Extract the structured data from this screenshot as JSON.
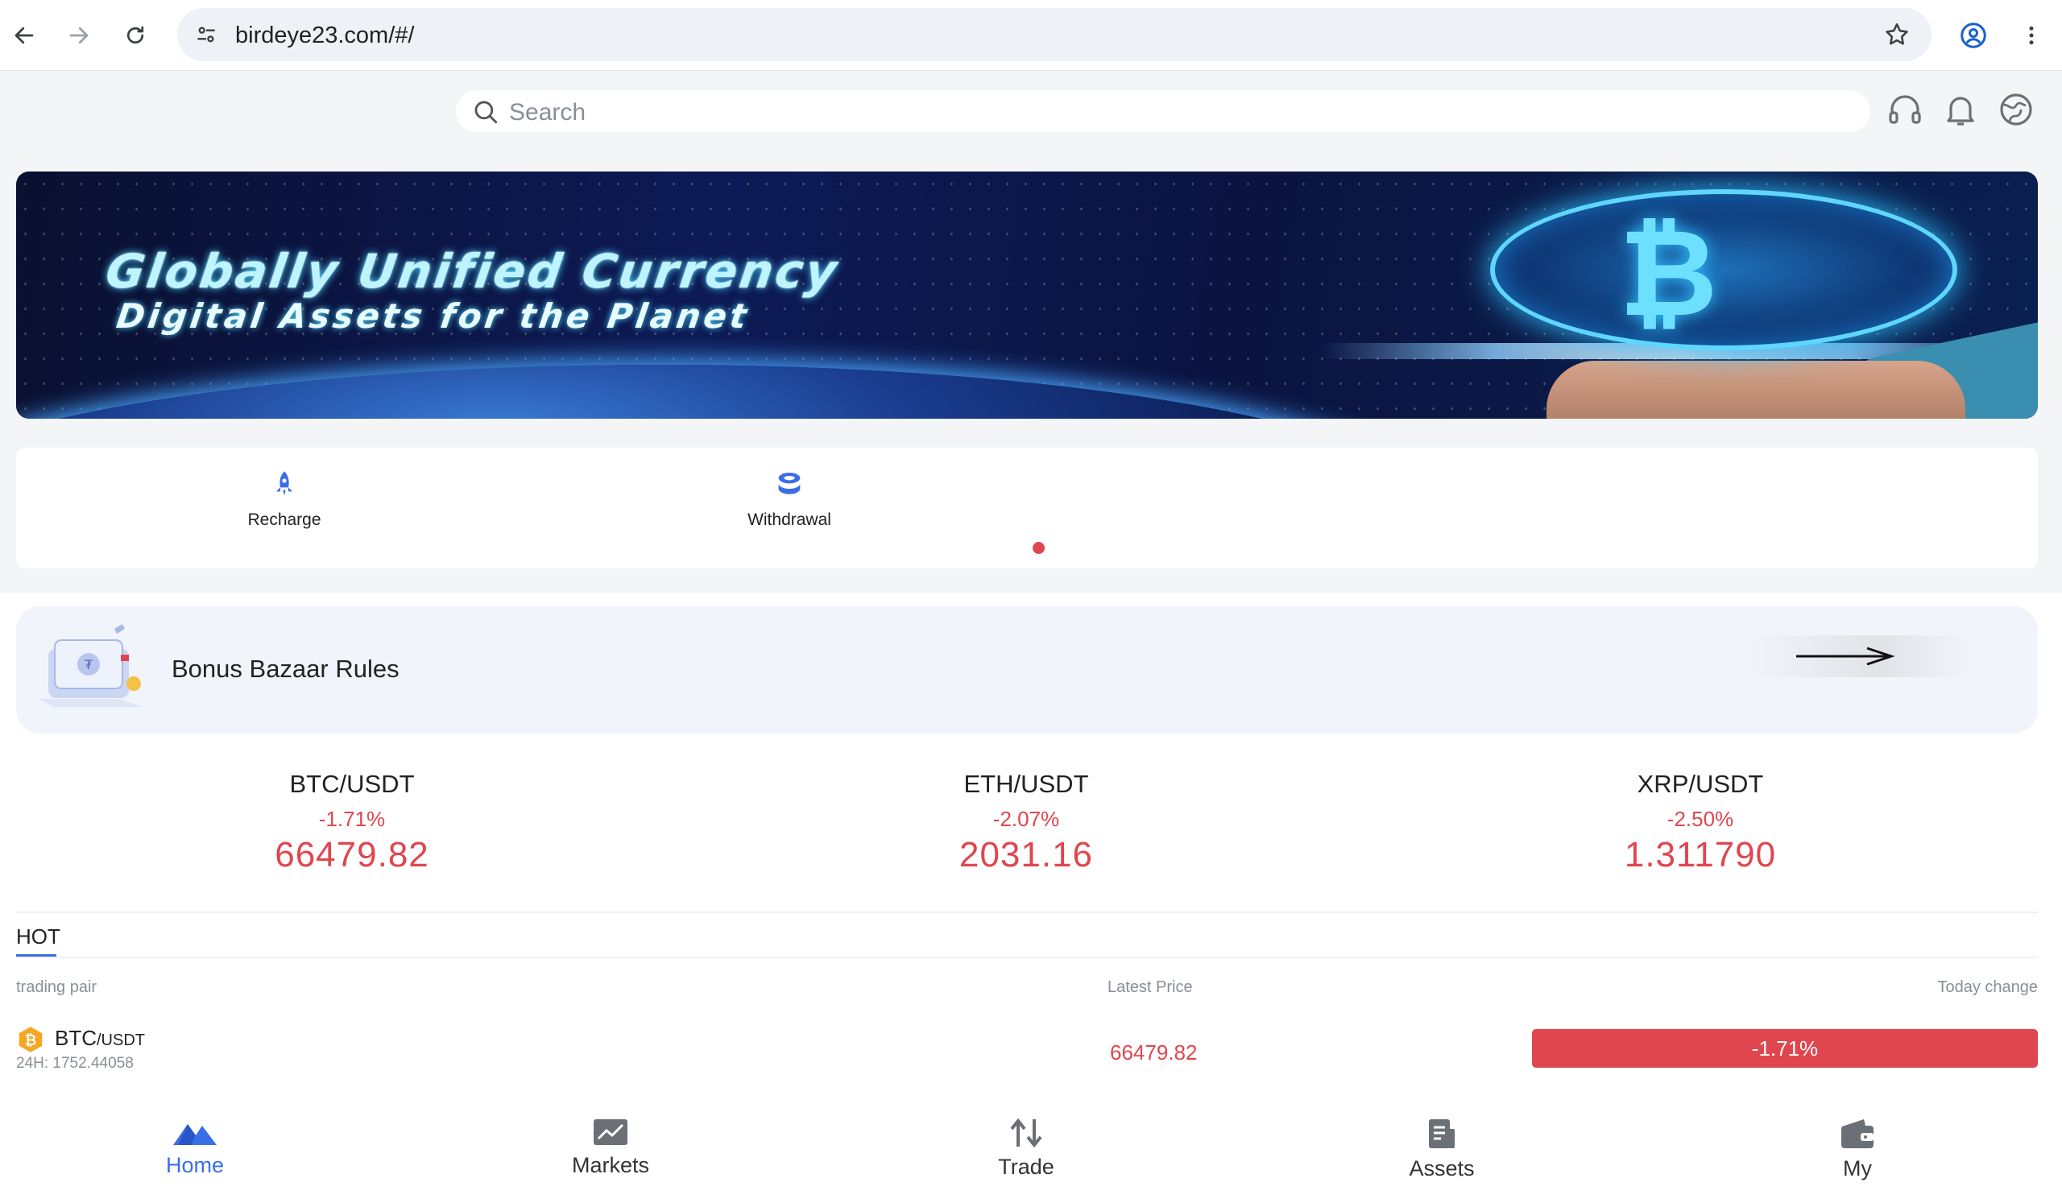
{
  "browser": {
    "url": "birdeye23.com/#/",
    "icons": [
      "back-arrow-icon",
      "forward-arrow-icon",
      "reload-icon",
      "site-settings-icon",
      "bookmark-star-icon",
      "profile-icon",
      "more-vert-icon"
    ]
  },
  "header": {
    "search_placeholder": "Search",
    "icons": [
      "headset-icon",
      "bell-icon",
      "globe-icon"
    ]
  },
  "banner": {
    "title": "Globally Unified Currency",
    "subtitle": "Digital Assets for the Planet"
  },
  "actions": [
    {
      "label": "Recharge",
      "icon": "rocket-icon"
    },
    {
      "label": "Withdrawal",
      "icon": "coins-icon"
    }
  ],
  "bonus": {
    "label": "Bonus Bazaar Rules",
    "icon": "arrow-right-icon"
  },
  "tickers": [
    {
      "pair": "BTC/USDT",
      "change": "-1.71%",
      "price": "66479.82"
    },
    {
      "pair": "ETH/USDT",
      "change": "-2.07%",
      "price": "2031.16"
    },
    {
      "pair": "XRP/USDT",
      "change": "-2.50%",
      "price": "1.311790"
    }
  ],
  "market": {
    "tab": "HOT",
    "headers": {
      "pair": "trading pair",
      "price": "Latest Price",
      "change": "Today change"
    },
    "rows": [
      {
        "base": "BTC",
        "quote": "/USDT",
        "volume": "24H: 1752.44058",
        "price": "66479.82",
        "change": "-1.71%"
      }
    ]
  },
  "tabbar": [
    {
      "label": "Home",
      "icon": "home-mountain-icon",
      "active": true
    },
    {
      "label": "Markets",
      "icon": "chart-icon",
      "active": false
    },
    {
      "label": "Trade",
      "icon": "up-down-arrows-icon",
      "active": false
    },
    {
      "label": "Assets",
      "icon": "document-icon",
      "active": false
    },
    {
      "label": "My",
      "icon": "wallet-icon",
      "active": false
    }
  ],
  "colors": {
    "accent": "#3a6ee8",
    "down": "#e0464f"
  }
}
